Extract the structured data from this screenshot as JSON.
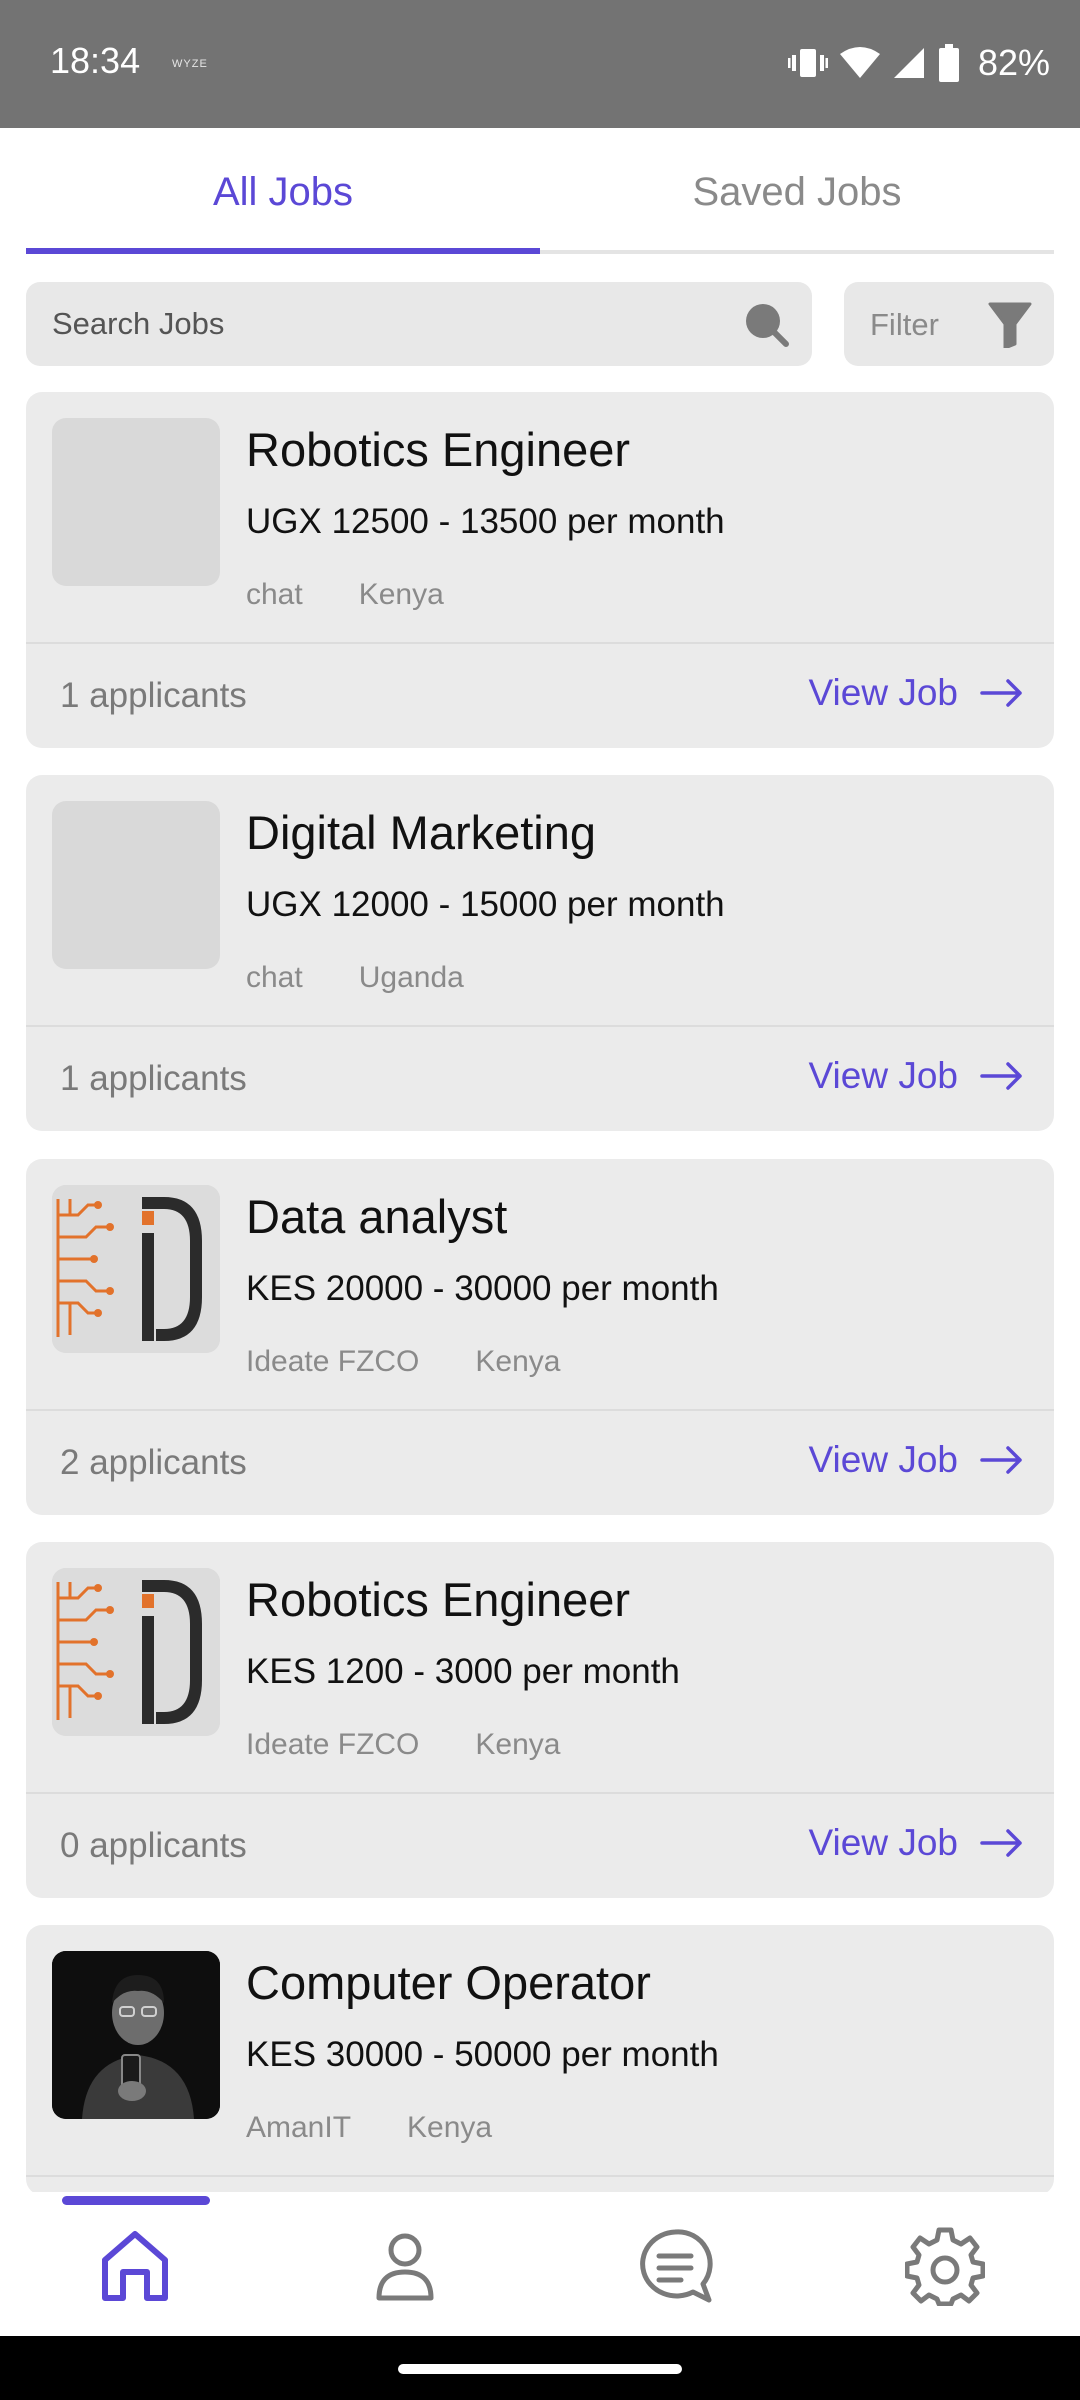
{
  "status_bar": {
    "time": "18:34",
    "carrier_label": "WYZE",
    "battery": "82%"
  },
  "tabs": [
    {
      "label": "All Jobs",
      "active": true
    },
    {
      "label": "Saved Jobs",
      "active": false
    }
  ],
  "search": {
    "placeholder": "Search Jobs"
  },
  "filter": {
    "label": "Filter"
  },
  "jobs": [
    {
      "title": "Robotics Engineer",
      "salary": "UGX 12500 - 13500 per month",
      "company": "chat",
      "location": "Kenya",
      "applicants": "1 applicants",
      "action": "View Job",
      "logo": "placeholder"
    },
    {
      "title": "Digital Marketing",
      "salary": "UGX 12000 - 15000 per month",
      "company": "chat",
      "location": "Uganda",
      "applicants": "1 applicants",
      "action": "View Job",
      "logo": "placeholder"
    },
    {
      "title": "Data analyst",
      "salary": "KES 20000 - 30000 per month",
      "company": "Ideate FZCO",
      "location": "Kenya",
      "applicants": "2 applicants",
      "action": "View Job",
      "logo": "ideate-logo"
    },
    {
      "title": "Robotics Engineer",
      "salary": "KES 1200 - 3000 per month",
      "company": "Ideate FZCO",
      "location": "Kenya",
      "applicants": "0 applicants",
      "action": "View Job",
      "logo": "ideate-logo"
    },
    {
      "title": "Computer Operator",
      "salary": "KES 30000 - 50000 per month",
      "company": "AmanIT",
      "location": "Kenya",
      "logo": "person-photo"
    }
  ],
  "bottom_nav": [
    {
      "icon": "home-icon",
      "active": true
    },
    {
      "icon": "profile-icon",
      "active": false
    },
    {
      "icon": "chat-icon",
      "active": false
    },
    {
      "icon": "settings-icon",
      "active": false
    }
  ],
  "colors": {
    "accent": "#5b48d6",
    "card_bg": "#ebebeb",
    "status_bar": "#737373",
    "muted_text": "#8a8a8a"
  }
}
